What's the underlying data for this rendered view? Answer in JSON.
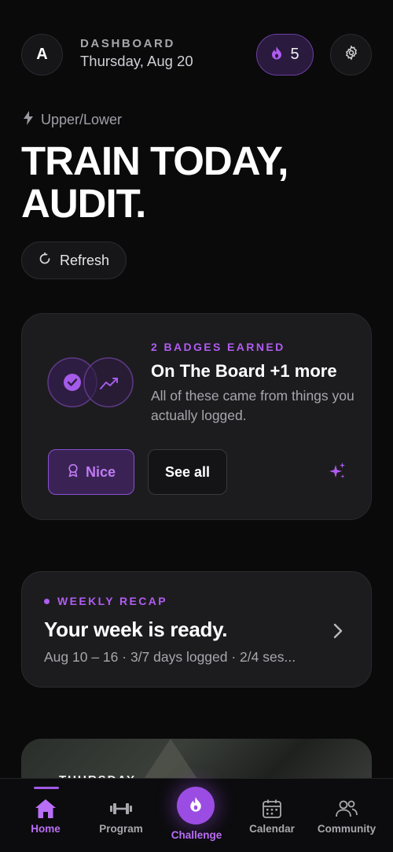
{
  "header": {
    "avatar_initial": "A",
    "section_label": "DASHBOARD",
    "date": "Thursday, Aug 20",
    "streak_count": "5"
  },
  "split": {
    "label": "Upper/Lower"
  },
  "hero": {
    "line1": "TRAIN TODAY,",
    "line2": "AUDIT."
  },
  "refresh": {
    "label": "Refresh"
  },
  "badges": {
    "kicker": "2 BADGES EARNED",
    "title": "On The Board +1 more",
    "subtitle": "All of these came from things you actually logged.",
    "nice_label": "Nice",
    "see_all_label": "See all"
  },
  "recap": {
    "kicker": "WEEKLY RECAP",
    "title": "Your week is ready.",
    "summary": "Aug 10 – 16 · 3/7 days logged · 2/4 ses..."
  },
  "photo_card": {
    "label": "THURSDAY"
  },
  "tabs": [
    {
      "label": "Home",
      "icon": "home-icon",
      "active": true
    },
    {
      "label": "Program",
      "icon": "dumbbell-icon",
      "active": false
    },
    {
      "label": "Challenge",
      "icon": "flame-icon",
      "active": false
    },
    {
      "label": "Calendar",
      "icon": "calendar-icon",
      "active": false
    },
    {
      "label": "Community",
      "icon": "people-icon",
      "active": false
    }
  ],
  "colors": {
    "accent": "#b15cf0",
    "background": "#0a0a0b",
    "card": "#1c1c1f"
  }
}
